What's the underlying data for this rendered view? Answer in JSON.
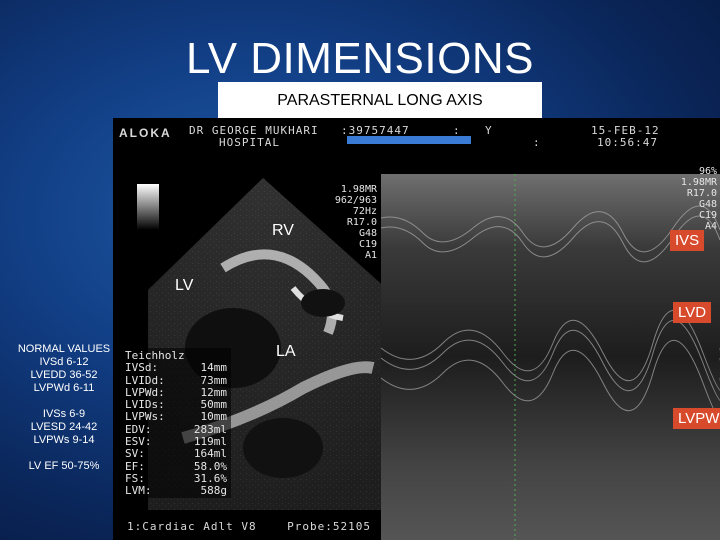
{
  "slide": {
    "title": "LV DIMENSIONS",
    "subtitle": "PARASTERNAL LONG AXIS"
  },
  "header": {
    "brand": "ALOKA",
    "doctor": "DR GEORGE MUKHARI",
    "hospital": "HOSPITAL",
    "patient_id": ":39757447",
    "sep1": ":",
    "sex": "Y",
    "colon2": ":",
    "date": "15-FEB-12",
    "time": "10:56:47"
  },
  "params_2d": [
    "1.98MR",
    "962/963",
    "72Hz",
    "R17.0",
    "G48",
    "C19",
    "A1"
  ],
  "params_mm": [
    "96%",
    "1.98MR",
    "R17.0",
    "G48",
    "C19",
    "A4"
  ],
  "labels": {
    "rv": "RV",
    "lv": "LV",
    "la": "LA",
    "ivs": "IVS",
    "lvd": "LVD",
    "lvpw": "LVPW"
  },
  "normal_values": {
    "heading": "NORMAL VALUES",
    "lines": [
      "IVSd 6-12",
      "LVEDD 36-52",
      "LVPWd 6-11",
      "",
      "IVSs 6-9",
      "LVESD 24-42",
      "LVPWs 9-14",
      "",
      "LV EF 50-75%"
    ]
  },
  "measurements": {
    "method": "Teichholz",
    "rows": [
      {
        "k": "IVSd:",
        "v": "14mm"
      },
      {
        "k": "LVIDd:",
        "v": "73mm"
      },
      {
        "k": "LVPWd:",
        "v": "12mm"
      },
      {
        "k": "LVIDs:",
        "v": "50mm"
      },
      {
        "k": "LVPWs:",
        "v": "10mm"
      },
      {
        "k": "EDV:",
        "v": "283ml"
      },
      {
        "k": "ESV:",
        "v": "119ml"
      },
      {
        "k": "SV:",
        "v": "164ml"
      },
      {
        "k": "EF:",
        "v": "58.0%"
      },
      {
        "k": "FS:",
        "v": "31.6%"
      },
      {
        "k": "LVM:",
        "v": "588g"
      }
    ]
  },
  "footer": {
    "preset": "1:Cardiac Adlt V8",
    "probe": "Probe:52105"
  },
  "colors": {
    "background": "#123f86",
    "label_box": "#d84a2c"
  }
}
